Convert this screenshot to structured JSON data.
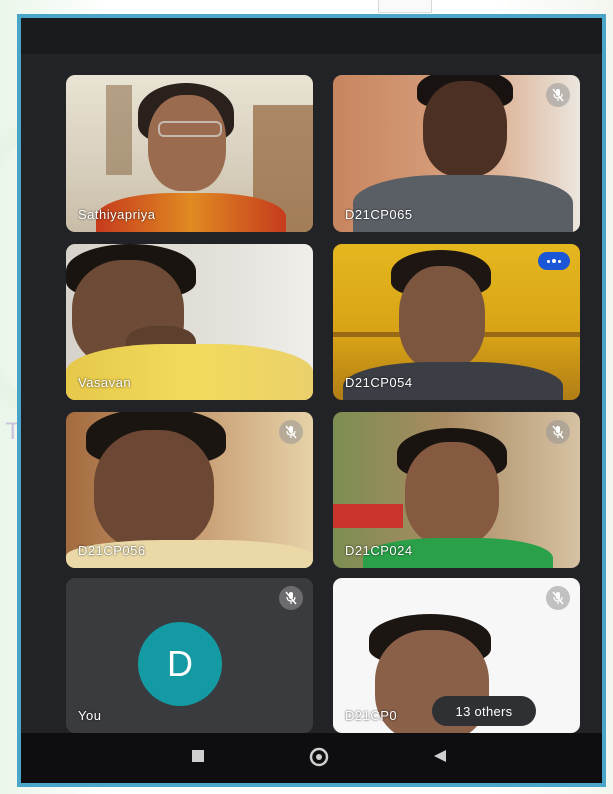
{
  "meeting": {
    "participants": [
      {
        "name": "Sathiyapriya",
        "muted": false,
        "speaking": false,
        "video": true
      },
      {
        "name": "D21CP065",
        "muted": true,
        "speaking": false,
        "video": true
      },
      {
        "name": "Vasavan",
        "muted": false,
        "speaking": false,
        "video": true
      },
      {
        "name": "D21CP054",
        "muted": false,
        "speaking": true,
        "video": true
      },
      {
        "name": "D21CP056",
        "muted": true,
        "speaking": false,
        "video": true
      },
      {
        "name": "D21CP024",
        "muted": true,
        "speaking": false,
        "video": true
      },
      {
        "name": "You",
        "muted": true,
        "speaking": false,
        "video": false,
        "avatar_letter": "D"
      },
      {
        "name": "D21CP0",
        "muted": true,
        "speaking": false,
        "video": true
      }
    ],
    "others_label": "13 others"
  },
  "colors": {
    "frame_border": "#4aa6c8",
    "app_background": "#222326",
    "avatar": "#139aa2",
    "speaking_badge": "#1a56d6"
  },
  "icons": {
    "mute": "mic-off-icon",
    "speaking": "audio-dots-icon",
    "nav_recents": "square-recents-icon",
    "nav_home": "circle-home-icon",
    "nav_back": "triangle-back-icon"
  }
}
